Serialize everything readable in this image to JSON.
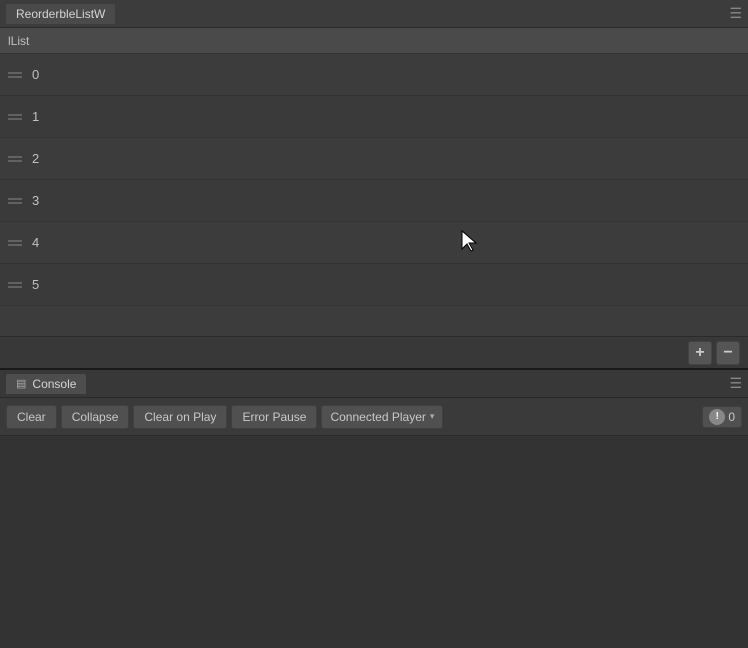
{
  "top_panel": {
    "title": "ReorderbleListW",
    "ilist_label": "lList",
    "items": [
      {
        "number": "0"
      },
      {
        "number": "1"
      },
      {
        "number": "2"
      },
      {
        "number": "3"
      },
      {
        "number": "4"
      },
      {
        "number": "5"
      }
    ],
    "add_button": "+",
    "remove_button": "−",
    "menu_icon": "☰"
  },
  "bottom_panel": {
    "title": "Console",
    "console_icon": "▤",
    "toolbar": {
      "clear_label": "Clear",
      "collapse_label": "Collapse",
      "clear_on_play_label": "Clear on Play",
      "error_pause_label": "Error Pause",
      "connected_player_label": "Connected Player",
      "dropdown_arrow": "▾",
      "warning_count": "0"
    },
    "menu_icon": "☰"
  }
}
